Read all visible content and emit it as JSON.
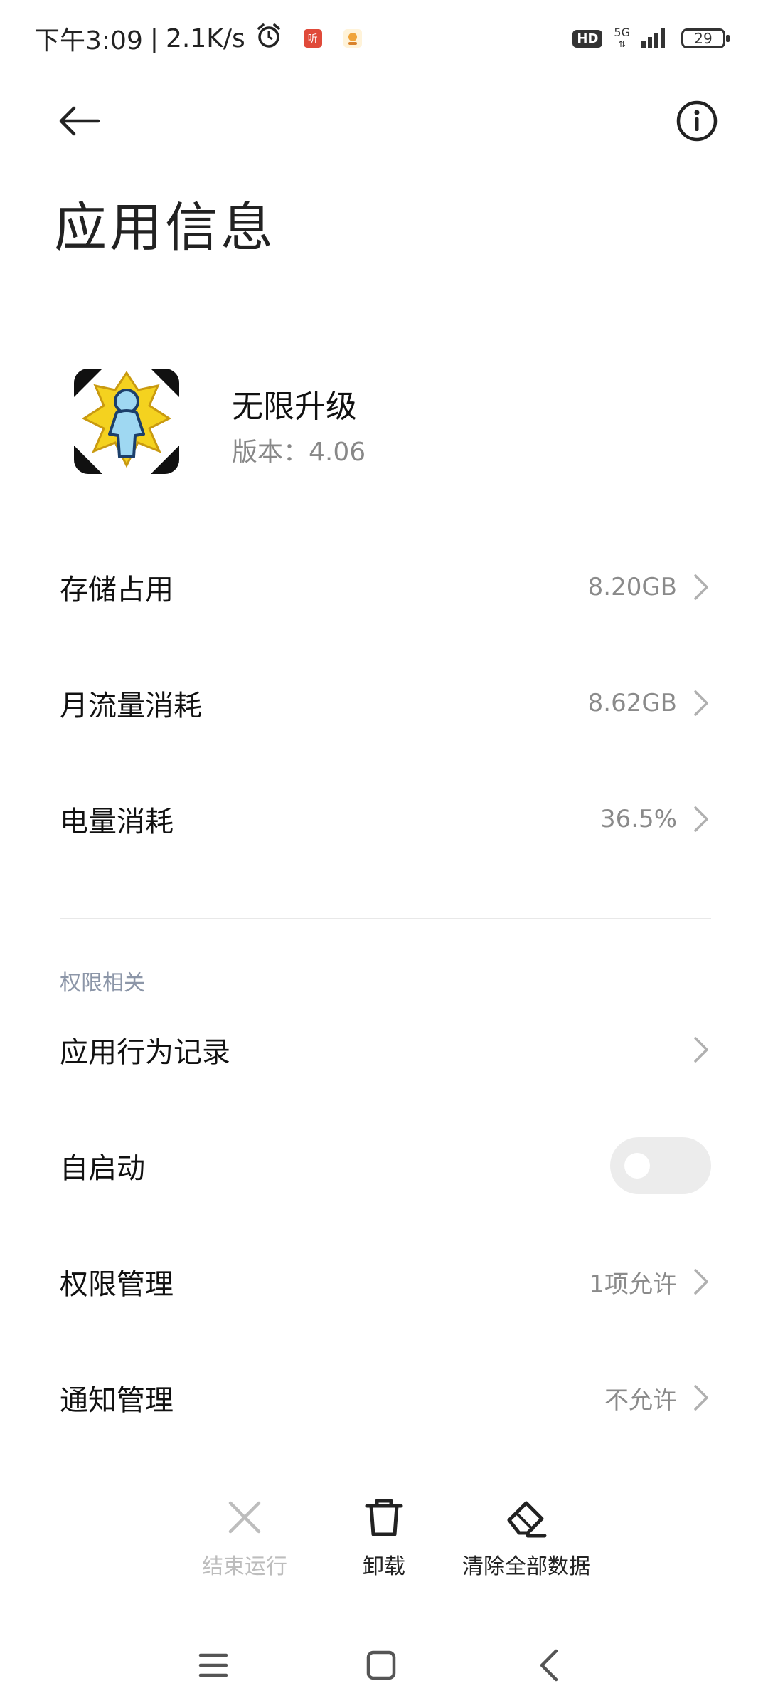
{
  "status_bar": {
    "time": "下午3:09",
    "separator": "|",
    "speed": "2.1K/s",
    "hd": "HD",
    "network": "5G",
    "battery": "29",
    "mini_app_1_text": "听"
  },
  "header": {
    "title": "应用信息"
  },
  "app": {
    "name": "无限升级",
    "version": "版本：4.06"
  },
  "usage": {
    "storage": {
      "label": "存储占用",
      "value": "8.20GB"
    },
    "data": {
      "label": "月流量消耗",
      "value": "8.62GB"
    },
    "battery": {
      "label": "电量消耗",
      "value": "36.5%"
    }
  },
  "permissions": {
    "section_label": "权限相关",
    "behavior_log": {
      "label": "应用行为记录"
    },
    "autostart": {
      "label": "自启动",
      "enabled": false
    },
    "permission_mgmt": {
      "label": "权限管理",
      "value": "1项允许"
    },
    "notification_mgmt": {
      "label": "通知管理",
      "value": "不允许"
    }
  },
  "actions": {
    "force_stop": "结束运行",
    "uninstall": "卸载",
    "clear_data": "清除全部数据"
  },
  "icons": [
    "back-arrow-icon",
    "info-icon",
    "alarm-icon",
    "chevron-right-icon",
    "close-icon",
    "trash-icon",
    "eraser-icon",
    "menu-icon",
    "home-square-icon",
    "back-nav-icon"
  ],
  "colors": {
    "muted": "#8a8a8a",
    "section": "#8c96a8",
    "disabled": "#bdbdbd",
    "toggle_off": "#ececec"
  }
}
